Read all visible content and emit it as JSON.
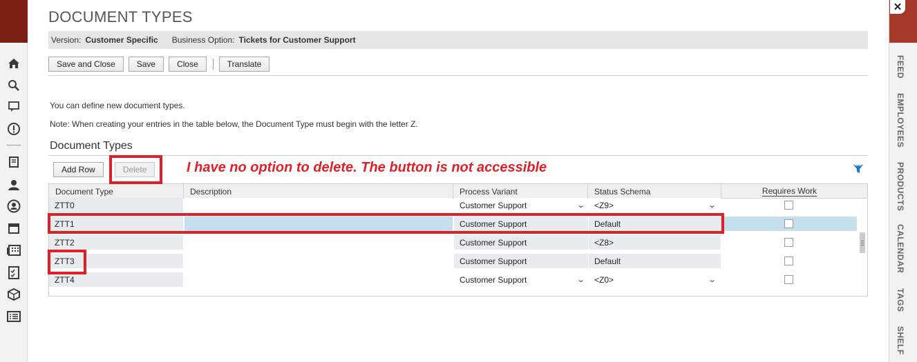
{
  "page": {
    "title": "DOCUMENT TYPES",
    "info": {
      "version_label": "Version:",
      "version_value": "Customer Specific",
      "business_option_label": "Business Option:",
      "business_option_value": "Tickets for Customer Support"
    },
    "toolbar": {
      "save_close": "Save and Close",
      "save": "Save",
      "close": "Close",
      "translate": "Translate"
    },
    "intro_text": "You can define new document types.",
    "note_text": "Note: When creating your entries in the table below, the Document Type must begin with the letter Z.",
    "section_title": "Document Types",
    "table_toolbar": {
      "add_row": "Add Row",
      "delete": "Delete"
    },
    "annotation": "I have no option to delete. The button is not accessible"
  },
  "table": {
    "headers": {
      "document_type": "Document Type",
      "description": "Description",
      "process_variant": "Process Variant",
      "status_schema": "Status Schema",
      "requires_work": "Requires Work"
    },
    "rows": [
      {
        "doc_type": "ZTT0",
        "description": "",
        "process_variant": "Customer Support",
        "status_schema": "<Z9>",
        "editable": true,
        "requires_work": false
      },
      {
        "doc_type": "ZTT1",
        "description": "",
        "process_variant": "Customer Support",
        "status_schema": "Default",
        "editable": false,
        "requires_work": false,
        "selected": true
      },
      {
        "doc_type": "ZTT2",
        "description": "",
        "process_variant": "Customer Support",
        "status_schema": "<Z8>",
        "editable": false,
        "requires_work": false
      },
      {
        "doc_type": "ZTT3",
        "description": "",
        "process_variant": "Customer Support",
        "status_schema": "Default",
        "editable": false,
        "requires_work": false
      },
      {
        "doc_type": "ZTT4",
        "description": "",
        "process_variant": "Customer Support",
        "status_schema": "<Z0>",
        "editable": true,
        "requires_work": false
      }
    ]
  },
  "right_tabs": [
    "FEED",
    "EMPLOYEES",
    "PRODUCTS",
    "CALENDAR",
    "TAGS",
    "SHELF"
  ],
  "left_icons": [
    "home-icon",
    "search-icon",
    "chat-icon",
    "alert-icon",
    "notebook-icon",
    "contacts-icon",
    "person-icon",
    "calendar-icon",
    "apps-icon",
    "checklist-icon",
    "box-icon",
    "list-icon"
  ],
  "colors": {
    "annotation_red": "#e01f26",
    "selected_row": "#c5dfed",
    "readonly_cell": "#e9ecef",
    "header_strip": "#7a1f12"
  }
}
